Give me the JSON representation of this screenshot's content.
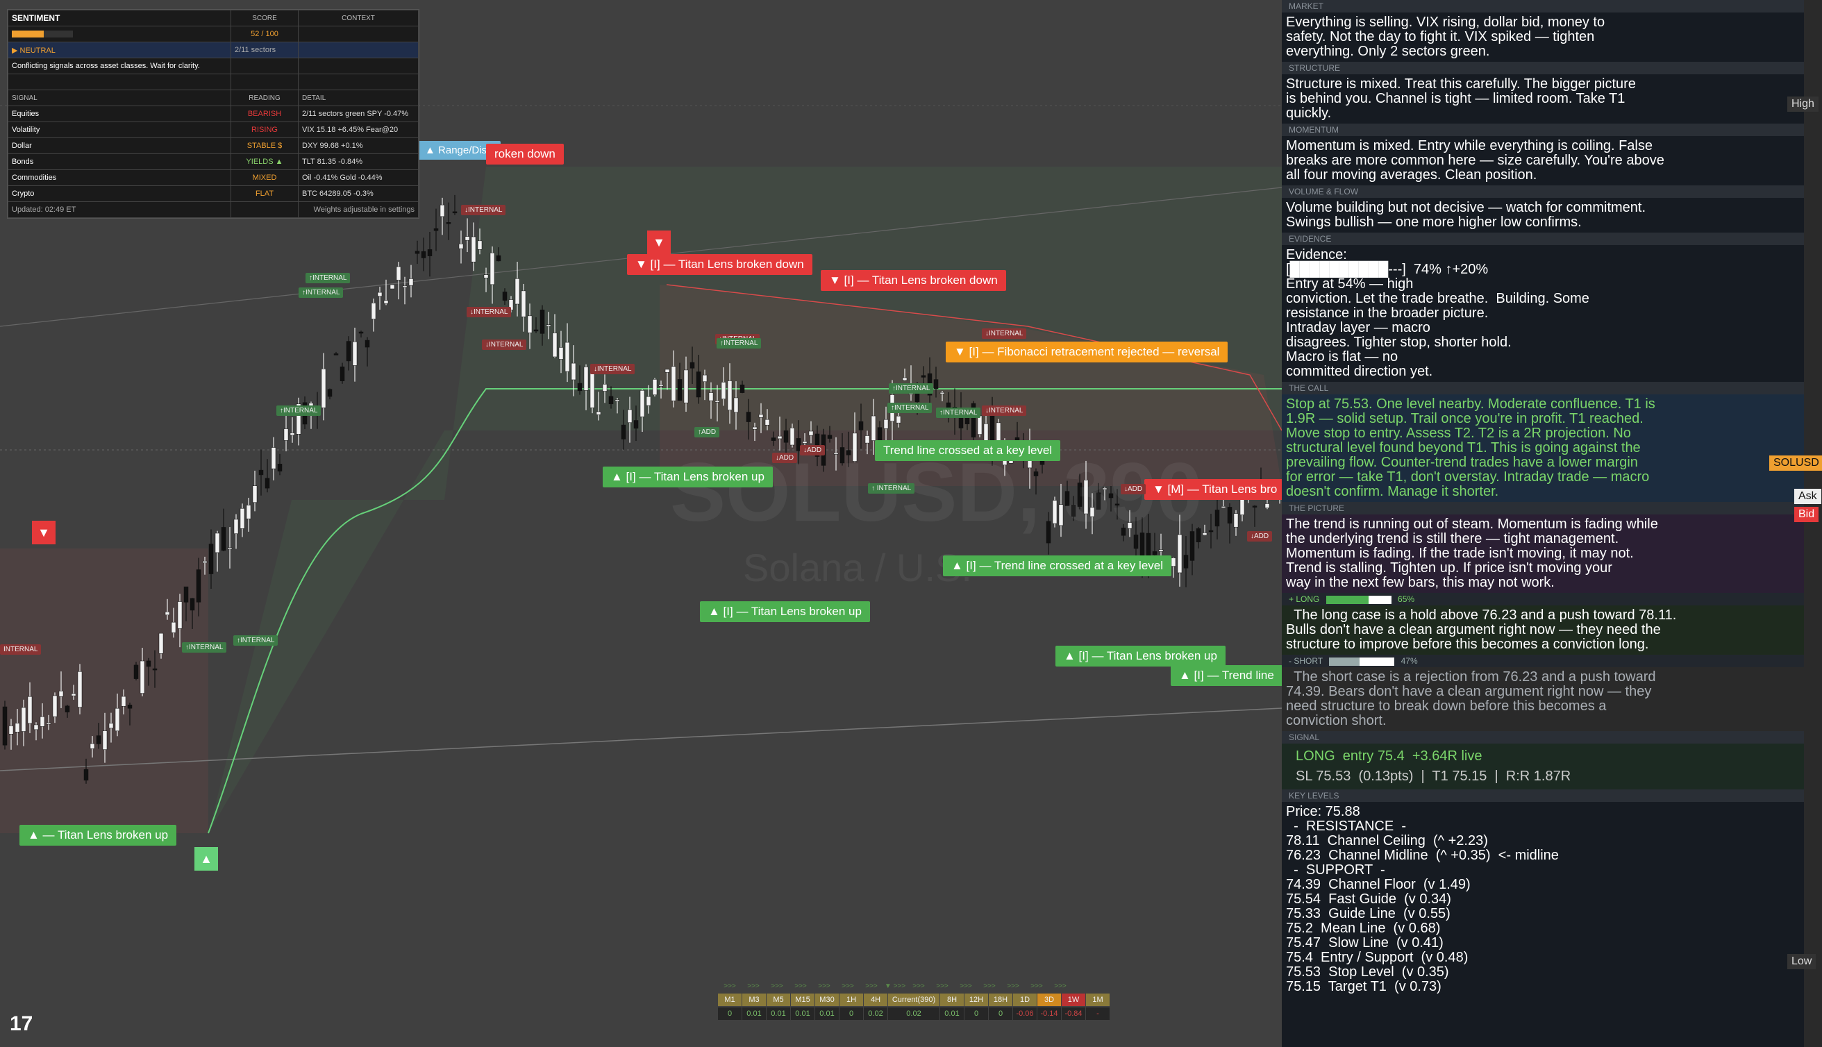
{
  "chart": {
    "watermark_symbol": "SOLUSD, 390",
    "watermark_name": "Solana / U.S.",
    "tv_logo": "17",
    "labels": [
      {
        "text": "▲ Range/Dist.",
        "color": "blue"
      },
      {
        "text": "roken down",
        "color": "red"
      },
      {
        "text": "▼ [I] — Titan Lens broken down",
        "color": "red"
      },
      {
        "text": "▼ [I] — Titan Lens broken down",
        "color": "red"
      },
      {
        "text": "▼ [I] — Fibonacci retracement rejected — reversal",
        "color": "orange"
      },
      {
        "text": "▼ [M] — Titan Lens bro",
        "color": "red"
      },
      {
        "text": "Trend line crossed at a key level",
        "color": "green"
      },
      {
        "text": "▲ [I] — Titan Lens broken up",
        "color": "green"
      },
      {
        "text": "▲ [I] — Trend line crossed at a key level",
        "color": "green"
      },
      {
        "text": "▲ [I] — Titan Lens broken up",
        "color": "green"
      },
      {
        "text": "▲ [I] — Titan Lens broken up",
        "color": "green"
      },
      {
        "text": "▲ [I] — Trend line",
        "color": "green"
      },
      {
        "text": "▲ — Titan Lens broken up",
        "color": "green"
      }
    ],
    "tags": [
      "↑INTERNAL",
      "↑INTERNAL",
      "↑INTERNAL",
      "↓INTERNAL",
      "↓INTERNAL",
      "↓INTERNAL",
      "↓INTERNAL",
      "↓INTERNAL",
      "↓INTERNAL",
      "↑INTERNAL",
      "↑INTERNAL",
      "↑INTERNAL",
      "↑ INTERNAL",
      "↑INTERNAL",
      "INTERNAL",
      "↓INTERNAL",
      "↑ADD",
      "↓ADD",
      "↓ADD",
      "↓ADD",
      "↓ADD",
      "↑INTERNAL",
      "↑INTERNAL"
    ],
    "timeframes": {
      "arrows": [
        ">>>",
        ">>>",
        ">>>",
        ">>>",
        ">>>",
        ">>>",
        ">>>",
        "▼ >>>",
        ">>>",
        ">>>",
        ">>>",
        ">>>",
        ">>>",
        ">>>",
        ">>>"
      ],
      "labels": [
        "M1",
        "M3",
        "M5",
        "M15",
        "M30",
        "1H",
        "4H",
        "Current(390)",
        "8H",
        "12H",
        "18H",
        "1D",
        "3D",
        "1W",
        "1M"
      ],
      "values": [
        "0",
        "0.01",
        "0.01",
        "0.01",
        "0.01",
        "0",
        "0.02",
        "0.02",
        "0.01",
        "0",
        "0",
        "-0.06",
        "-0.14",
        "-0.84",
        "-"
      ]
    }
  },
  "sentiment": {
    "title": "SENTIMENT",
    "col_score": "SCORE",
    "col_context": "CONTEXT",
    "score_value": 52,
    "score": "52 / 100",
    "state": "▶ NEUTRAL",
    "sectors": "2/11 sectors",
    "message": "Conflicting signals across asset classes. Wait for clarity.",
    "col_signal": "SIGNAL",
    "col_reading": "READING",
    "col_detail": "DETAIL",
    "rows": [
      {
        "signal": "Equities",
        "reading": "BEARISH",
        "detail": "2/11 sectors green  SPY -0.47%",
        "cls": "c-red"
      },
      {
        "signal": "Volatility",
        "reading": "RISING",
        "detail": "VIX 15.18  +6.45%  Fear@20",
        "cls": "c-red"
      },
      {
        "signal": "Dollar",
        "reading": "STABLE $",
        "detail": "DXY 99.68  +0.1%",
        "cls": "c-orange"
      },
      {
        "signal": "Bonds",
        "reading": "YIELDS ▲",
        "detail": "TLT 81.35  -0.84%",
        "cls": "c-green"
      },
      {
        "signal": "Commodities",
        "reading": "MIXED",
        "detail": "Oil -0.41%  Gold -0.44%",
        "cls": "c-orange"
      },
      {
        "signal": "Crypto",
        "reading": "FLAT",
        "detail": "BTC 64289.05  -0.3%",
        "cls": "c-orange"
      }
    ],
    "updated": "Updated: 02:49 ET",
    "weights_note": "Weights adjustable in settings"
  },
  "panel": {
    "market_title": "MARKET",
    "market_text": "Everything is selling. VIX rising, dollar bid, money to\nsafety. Not the day to fight it. VIX spiked — tighten\neverything. Only 2 sectors green.",
    "structure_title": "STRUCTURE",
    "structure_text": "Structure is mixed. Treat this carefully. The bigger picture\nis behind you. Channel is tight — limited room. Take T1\nquickly.",
    "momentum_title": "MOMENTUM",
    "momentum_text": "Momentum is mixed. Entry while everything is coiling. False\nbreaks are more common here — size carefully. You're above\nall four moving averages. Clean position.",
    "volume_title": "VOLUME & FLOW",
    "volume_text": "Volume building but not decisive — watch for commitment.\nSwings bullish — one more higher low confirms.",
    "evidence_title": "EVIDENCE",
    "evidence_text": "Evidence:\n[██████████---]  74% ↑+20%\nEntry at 54% — high\nconviction. Let the trade breathe.  Building. Some\nresistance in the broader picture.\nIntraday layer — macro\ndisagrees. Tighter stop, shorter hold.\nMacro is flat — no\ncommitted direction yet.",
    "call_title": "THE CALL",
    "call_text": "Stop at 75.53. One level nearby. Moderate confluence. T1 is\n1.9R — solid setup. Trail once you're in profit. T1 reached.\nMove stop to entry. Assess T2. T2 is a 2R projection. No\nstructural level found beyond T1. This is going against the\nprevailing flow. Counter-trend trades have a lower margin\nfor error — take T1, don't overstay. Intraday trade — macro\ndoesn't confirm. Manage it shorter.",
    "picture_title": "THE PICTURE",
    "picture_text": "The trend is running out of steam. Momentum is fading while\nthe underlying trend is still there — tight management.\nMomentum is fading. If the trade isn't moving, it may not.\nTrend is stalling. Tighten up. If price isn't moving your\nway in the next few bars, this may not work.",
    "long_label": "+ LONG",
    "long_value": 65,
    "long_pct": "65%",
    "long_text": "  The long case is a hold above 76.23 and a push toward 78.11.\nBulls don't have a clean argument right now — they need the\nstructure to improve before this becomes a conviction long.",
    "short_label": "- SHORT",
    "short_value": 47,
    "short_pct": "47%",
    "short_text": "  The short case is a rejection from 76.23 and a push toward\n74.39. Bears don't have a clean argument right now — they\nneed structure to break down before this becomes a\nconviction short.",
    "signal_title": "SIGNAL",
    "signal_line1": "LONG  entry 75.4  +3.64R live",
    "signal_line2": "SL 75.53  (0.13pts)  |  T1 75.15  |  R:R 1.87R",
    "levels_title": "KEY LEVELS",
    "levels_text": "Price: 75.88\n  -  RESISTANCE  -\n78.11  Channel Ceiling  (^ +2.23)\n76.23  Channel Midline  (^ +0.35)  <- midline\n  -  SUPPORT  -\n74.39  Channel Floor  (v 1.49)\n75.54  Fast Guide  (v 0.34)\n75.33  Guide Line  (v 0.55)\n75.2  Mean Line  (v 0.68)\n75.47  Slow Line  (v 0.41)\n75.4  Entry / Support  (v 0.48)\n75.53  Stop Level  (v 0.35)\n75.15  Target T1  (v 0.73)"
  },
  "edge": {
    "high": "High",
    "solusd": "SOLUSD",
    "ask": "Ask",
    "bid": "Bid",
    "low": "Low"
  }
}
